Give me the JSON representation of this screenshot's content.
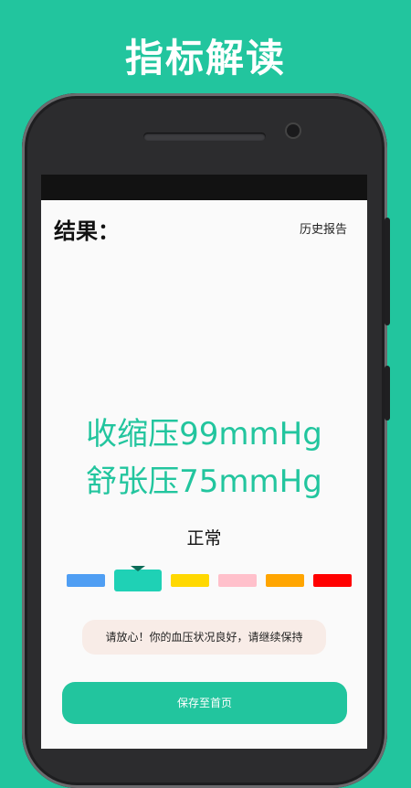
{
  "headline": "指标解读",
  "header": {
    "result_label": "结果：",
    "history_link": "历史报告"
  },
  "reading": {
    "systolic": "收缩压99mmHg",
    "diastolic": "舒张压75mmHg",
    "status": "正常"
  },
  "scale": {
    "active_index": 1,
    "segments": [
      {
        "name": "blue",
        "color": "#4f9ef3"
      },
      {
        "name": "teal",
        "color": "#1fd1b5"
      },
      {
        "name": "yellow",
        "color": "#ffd800"
      },
      {
        "name": "pink",
        "color": "#ffc0cb"
      },
      {
        "name": "orange",
        "color": "#ffa500"
      },
      {
        "name": "red",
        "color": "#ff0000"
      }
    ]
  },
  "tip": "请放心！你的血压状况良好，请继续保持",
  "actions": {
    "save_label": "保存至首页"
  },
  "colors": {
    "accent": "#22c59e",
    "tip_bg": "#f8ece7"
  }
}
